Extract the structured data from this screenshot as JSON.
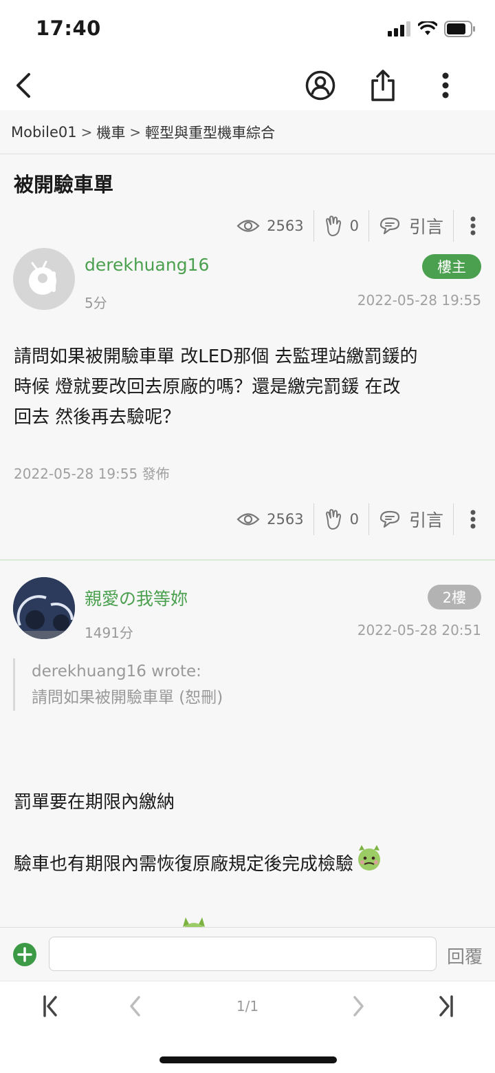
{
  "status_bar": {
    "time": "17:40"
  },
  "breadcrumb": {
    "items": [
      "Mobile01",
      "機車",
      "輕型與重型機車綜合"
    ],
    "separator": ">"
  },
  "post": {
    "title": "被開驗車單",
    "views": "2563",
    "likes": "0",
    "quote_label": "引言",
    "author": "derekhuang16",
    "points": "5分",
    "badge": "樓主",
    "timestamp": "2022-05-28 19:55",
    "body_lines": [
      "請問如果被開驗車單 改LED那個 去監理站繳罰鍰的",
      "時候 燈就要改回去原廠的嗎？還是繳完罰鍰 在改",
      "回去 然後再去驗呢？"
    ],
    "published": "2022-05-28 19:55 發佈"
  },
  "reply": {
    "author": "親愛の我等妳",
    "points": "1491分",
    "floor": "2樓",
    "timestamp": "2022-05-28 20:51",
    "quote_author": "derekhuang16 wrote:",
    "quote_text": "請問如果被開驗車單 (恕刪)",
    "lines": [
      "罰單要在期限內繳納",
      "驗車也有期限內需恢復原廠規定後完成檢驗"
    ]
  },
  "reply_bar": {
    "input_value": "",
    "submit_label": "回覆"
  },
  "pager": {
    "page": "1/1"
  },
  "colors": {
    "accent_green": "#4aa04e",
    "badge_owner": "#4aa04e",
    "badge_floor": "#b3b3b3"
  },
  "icons": [
    "back-icon",
    "account-icon",
    "share-icon",
    "more-icon",
    "eye-icon",
    "clap-icon",
    "quote-bubble-icon",
    "plus-icon",
    "first-page-icon",
    "prev-page-icon",
    "next-page-icon",
    "last-page-icon",
    "devil-emoji-icon"
  ]
}
